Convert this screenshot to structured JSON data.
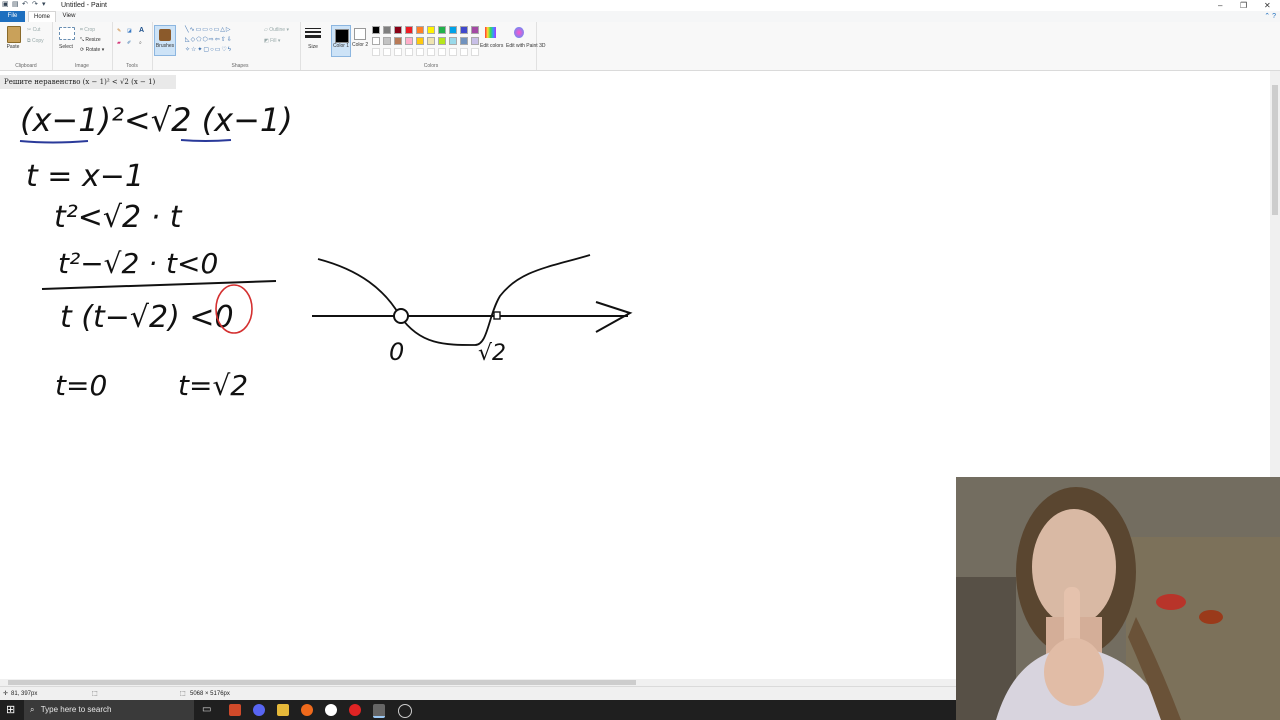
{
  "window": {
    "title": "Untitled - Paint",
    "tabs": [
      {
        "label": "File"
      },
      {
        "label": "Home"
      },
      {
        "label": "View"
      }
    ],
    "controls": [
      "–",
      "❐",
      "✕"
    ]
  },
  "ribbon": {
    "clipboard": {
      "paste": "Paste",
      "cut": "Cut",
      "copy": "Copy",
      "group": "Clipboard"
    },
    "image": {
      "select": "Select",
      "crop": "Crop",
      "resize": "Resize",
      "rotate": "Rotate ▾",
      "group": "Image"
    },
    "tools": {
      "group": "Tools",
      "text_tool": "A"
    },
    "brushes": {
      "label": "Brushes"
    },
    "shapes": {
      "outline": "Outline ▾",
      "fill": "Fill ▾",
      "group": "Shapes"
    },
    "size": {
      "label": "Size"
    },
    "colors": {
      "color1": "Color 1",
      "color2": "Color 2",
      "edit_colors": "Edit colors",
      "edit_paint3d": "Edit with Paint 3D",
      "group": "Colors",
      "palette_row1": [
        "#000000",
        "#7f7f7f",
        "#880015",
        "#ed1c24",
        "#ff7f27",
        "#fff200",
        "#22b14c",
        "#00a2e8",
        "#3f48cc",
        "#a349a4"
      ],
      "palette_row2": [
        "#ffffff",
        "#c3c3c3",
        "#b97a57",
        "#ffaec9",
        "#ffc90e",
        "#efe4b0",
        "#b5e61d",
        "#99d9ea",
        "#7092be",
        "#c8bfe7"
      ]
    }
  },
  "prompt": "Решите неравенство (x − 1)² < √2 (x − 1)",
  "handwriting": {
    "line1": "(x−1)²<√2 (x−1)",
    "line2": "t = x−1",
    "line3": "t²<√2 · t",
    "line4": "t²−√2 · t<0",
    "line5": "t (t−√2) <0",
    "line6a": "t=0",
    "line6b": "t=√2",
    "graph_label_0": "0",
    "graph_label_sqrt2": "√2"
  },
  "status": {
    "cursor_pos": "81, 397px",
    "canvas_size": "5068 × 5176px"
  },
  "taskbar": {
    "search_placeholder": "Type here to search"
  }
}
